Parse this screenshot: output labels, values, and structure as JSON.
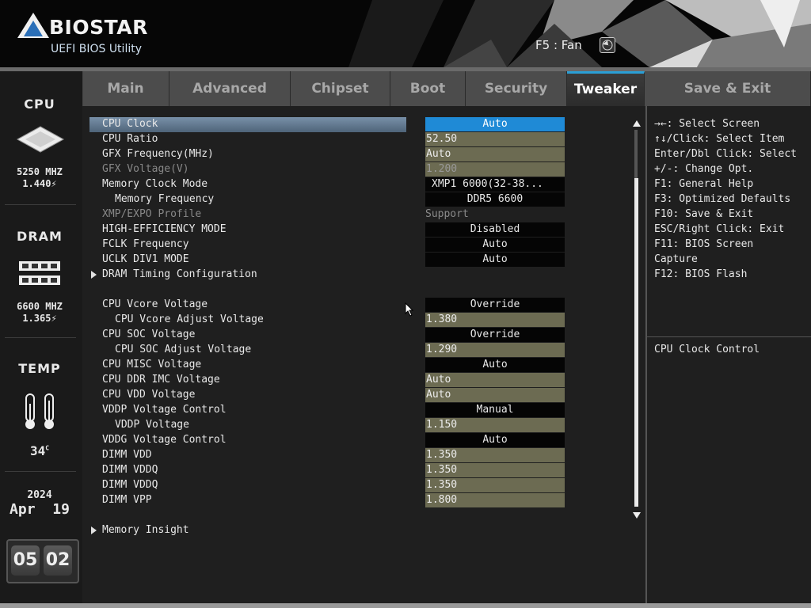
{
  "header": {
    "brand": "BIOSTAR",
    "subtitle": "UEFI BIOS Utility",
    "fan_hotkey": "F5 : Fan"
  },
  "tabs": [
    {
      "label": "Main"
    },
    {
      "label": "Advanced"
    },
    {
      "label": "Chipset"
    },
    {
      "label": "Boot"
    },
    {
      "label": "Security"
    },
    {
      "label": "Tweaker",
      "active": true
    },
    {
      "label": "Save & Exit"
    }
  ],
  "left_panel": {
    "cpu_title": "CPU",
    "cpu_freq": "5250 MHZ",
    "cpu_volt": "1.440",
    "dram_title": "DRAM",
    "dram_freq": "6600 MHZ",
    "dram_volt": "1.365",
    "temp_title": "TEMP",
    "temp_value": "34",
    "temp_unit": "C",
    "year": "2024",
    "month": "Apr",
    "day": "19",
    "hour": "05",
    "minute": "02"
  },
  "settings": [
    {
      "label": "CPU Clock",
      "value": "Auto",
      "selected": true
    },
    {
      "label": "CPU Ratio",
      "value": "52.50"
    },
    {
      "label": "GFX Frequency(MHz)",
      "value": "Auto"
    },
    {
      "label": "GFX Voltage(V)",
      "value": "1.200",
      "disabled": true
    },
    {
      "label": "Memory Clock Mode",
      "value": "XMP1 6000(32-38..."
    },
    {
      "label": "Memory Frequency",
      "value": "DDR5 6600"
    },
    {
      "label": "XMP/EXPO Profile",
      "value": "Support",
      "disabled": true
    },
    {
      "label": "HIGH-EFFICIENCY MODE",
      "value": "Disabled"
    },
    {
      "label": "FCLK Frequency",
      "value": "Auto"
    },
    {
      "label": "UCLK DIV1 MODE",
      "value": "Auto"
    },
    {
      "label": "DRAM Timing Configuration"
    },
    {
      "label": "CPU Vcore Voltage",
      "value": "Override"
    },
    {
      "label": "CPU Vcore Adjust Voltage",
      "value": "1.380"
    },
    {
      "label": "CPU SOC Voltage",
      "value": "Override"
    },
    {
      "label": "CPU SOC Adjust Voltage",
      "value": "1.290"
    },
    {
      "label": "CPU MISC Voltage",
      "value": "Auto"
    },
    {
      "label": "CPU DDR IMC Voltage",
      "value": "Auto"
    },
    {
      "label": "CPU VDD Voltage",
      "value": "Auto"
    },
    {
      "label": "VDDP Voltage Control",
      "value": "Manual"
    },
    {
      "label": "VDDP Voltage",
      "value": "1.150"
    },
    {
      "label": "VDDG Voltage Control",
      "value": "Auto"
    },
    {
      "label": "DIMM VDD",
      "value": "1.350"
    },
    {
      "label": "DIMM VDDQ",
      "value": "1.350"
    },
    {
      "label": "DIMM VDDQ",
      "value": "1.350"
    },
    {
      "label": "DIMM VPP",
      "value": "1.800"
    },
    {
      "label": "Memory Insight"
    }
  ],
  "help": {
    "keys": [
      ": Select Screen",
      "/Click: Select Item",
      "Enter/Dbl Click: Select",
      "+/-: Change Opt.",
      "F1: General Help",
      "F3: Optimized Defaults",
      "F10: Save & Exit",
      "ESC/Right Click: Exit",
      "F11: BIOS Screen",
      "Capture",
      "F12: BIOS Flash"
    ],
    "description": "CPU Clock Control"
  }
}
